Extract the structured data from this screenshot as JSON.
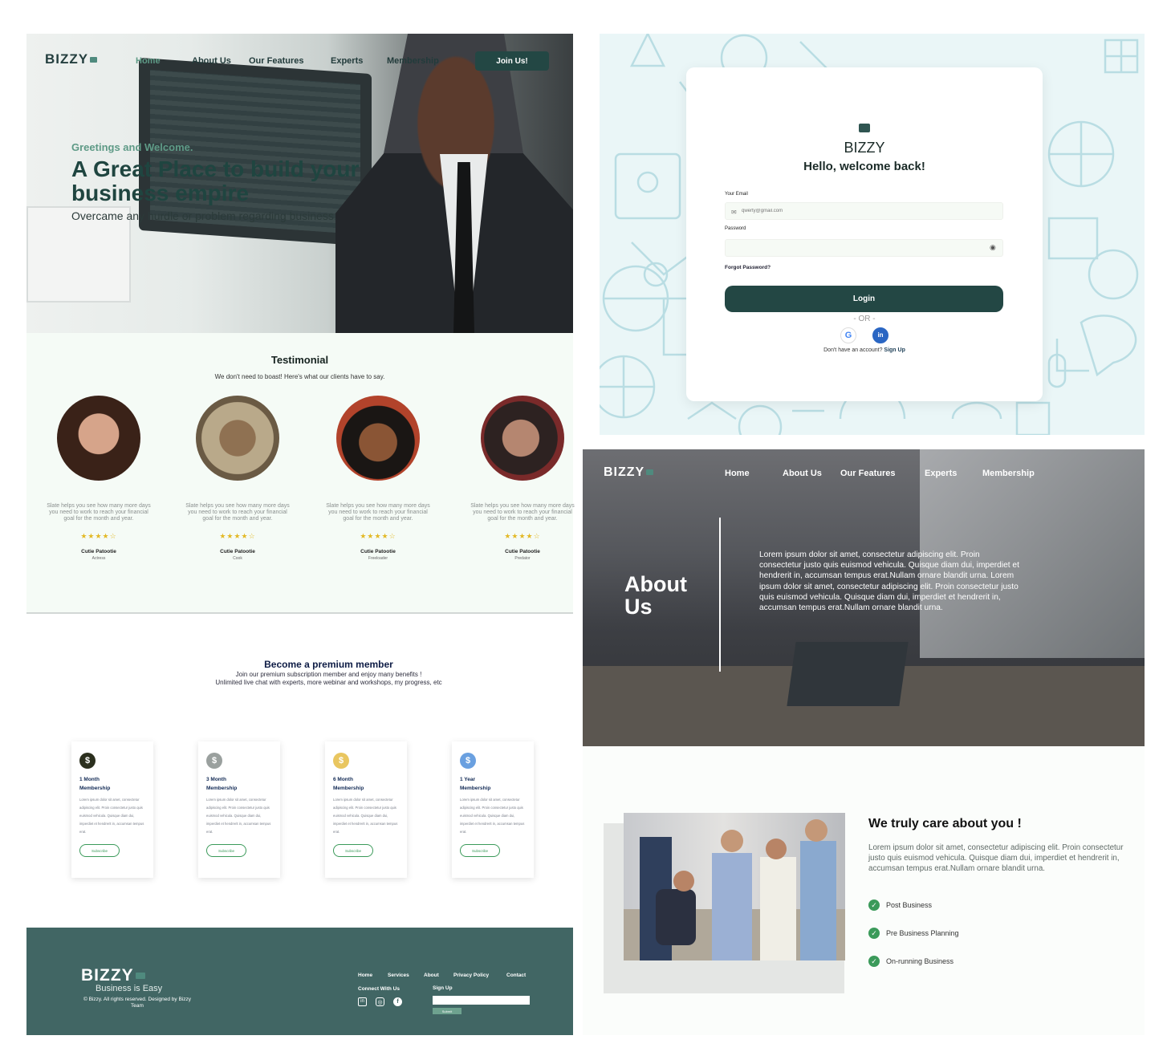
{
  "landing": {
    "brand": "BIZZY",
    "nav": [
      "Home",
      "About Us",
      "Our Features",
      "Experts",
      "Membership"
    ],
    "join_label": "Join Us!",
    "greeting": "Greetings and Welcome.",
    "title": "A Great Place to build your business empire",
    "subtitle": "Overcame any hurdle or problem regarding business.",
    "testimonial": {
      "heading": "Testimonial",
      "subheading": "We don't need to boast! Here's what our clients have to say.",
      "cards": [
        {
          "text": "Slate helps you see how many more days you need to work to reach your financial goal for the month and year.",
          "stars": "★★★★☆",
          "rating": 4,
          "name": "Cutie Patootie",
          "role": "Actress"
        },
        {
          "text": "Slate helps you see how many more days you need to work to reach your financial goal for the month and year.",
          "stars": "★★★★☆",
          "rating": 4,
          "name": "Cutie Patootie",
          "role": "Cook"
        },
        {
          "text": "Slate helps you see how many more days you need to work to reach your financial goal for the month and year.",
          "stars": "★★★★☆",
          "rating": 4,
          "name": "Cutie Patootie",
          "role": "Freeloader"
        },
        {
          "text": "Slate helps you see how many more days you need to work to reach your financial goal for the month and year.",
          "stars": "★★★★☆",
          "rating": 4,
          "name": "Cutie Patootie",
          "role": "Predator"
        }
      ]
    },
    "premium": {
      "heading": "Become a premium member",
      "desc1": "Join our premium subscription member and enjoy many benefits !",
      "desc2": "Unlimited live chat with experts,  more webinar and workshops, my progress, etc",
      "plans": [
        {
          "title1": "1 Month",
          "title2": "Membership",
          "color": "#2b2f1e",
          "desc": "Lorem ipsum dolor sit amet, consectetur adipiscing elit. Proin consectetur justo quis euismod vehicula. Quisque diam dui, imperdiet et hendrerit in, accumsan tempus erat.",
          "button": "Subscribe"
        },
        {
          "title1": "3 Month",
          "title2": "Membership",
          "color": "#9aa09e",
          "desc": "Lorem ipsum dolor sit amet, consectetur adipiscing elit. Proin consectetur justo quis euismod vehicula. Quisque diam dui, imperdiet et hendrerit in, accumsan tempus erat.",
          "button": "Subscribe"
        },
        {
          "title1": "6 Month",
          "title2": "Membership",
          "color": "#e9c660",
          "desc": "Lorem ipsum dolor sit amet, consectetur adipiscing elit. Proin consectetur justo quis euismod vehicula. Quisque diam dui, imperdiet et hendrerit in, accumsan tempus erat.",
          "button": "Subscribe"
        },
        {
          "title1": "1 Year",
          "title2": "Membership",
          "color": "#6aa0e0",
          "desc": "Lorem ipsum dolor sit amet, consectetur adipiscing elit. Proin consectetur justo quis euismod vehicula. Quisque diam dui, imperdiet et hendrerit in, accumsan tempus erat.",
          "button": "Subscribe"
        }
      ]
    },
    "footer": {
      "brand": "BIZZY",
      "tagline": "Business is Easy",
      "copyright": "© Bizzy. All rights reserved. Designed by Bizzy Team",
      "links": [
        "Home",
        "Services",
        "About",
        "Privacy Policy",
        "Contact"
      ],
      "connect": "Connect With Us",
      "signup": "Sign Up",
      "submit": "Submit",
      "social_icons": [
        "linkedin-icon",
        "instagram-icon",
        "facebook-icon"
      ]
    }
  },
  "login": {
    "brand": "BIZZY",
    "welcome": "Hello, welcome back!",
    "email_label": "Your Email",
    "email_placeholder": "qwerty@gmail.com",
    "password_label": "Password",
    "forgot": "Forgot Password?",
    "login_button": "Login",
    "or": "- OR -",
    "no_account": "Don't have an account?",
    "signup": "Sign Up",
    "social": [
      "google-icon",
      "linkedin-icon"
    ]
  },
  "about": {
    "brand": "BIZZY",
    "nav": [
      "Home",
      "About Us",
      "Our Features",
      "Experts",
      "Membership"
    ],
    "title": "About Us",
    "text": "Lorem ipsum dolor sit amet, consectetur adipiscing elit. Proin consectetur justo quis euismod vehicula. Quisque diam dui, imperdiet et hendrerit in, accumsan tempus erat.Nullam ornare blandit urna. Lorem ipsum dolor sit amet, consectetur adipiscing elit. Proin consectetur justo quis euismod vehicula. Quisque diam dui, imperdiet et hendrerit in, accumsan tempus erat.Nullam ornare blandit urna.",
    "care_heading": "We truly care about you !",
    "care_text": "Lorem ipsum dolor sit amet, consectetur adipiscing elit. Proin consectetur justo quis euismod vehicula. Quisque diam dui, imperdiet et hendrerit in, accumsan tempus erat.Nullam ornare blandit urna.",
    "checks": [
      "Post Business",
      "Pre Business Planning",
      "On-running Business"
    ]
  },
  "colors": {
    "primary": "#234744",
    "accent_green": "#5e9a86",
    "footer": "#416664",
    "star": "#e3b927"
  }
}
